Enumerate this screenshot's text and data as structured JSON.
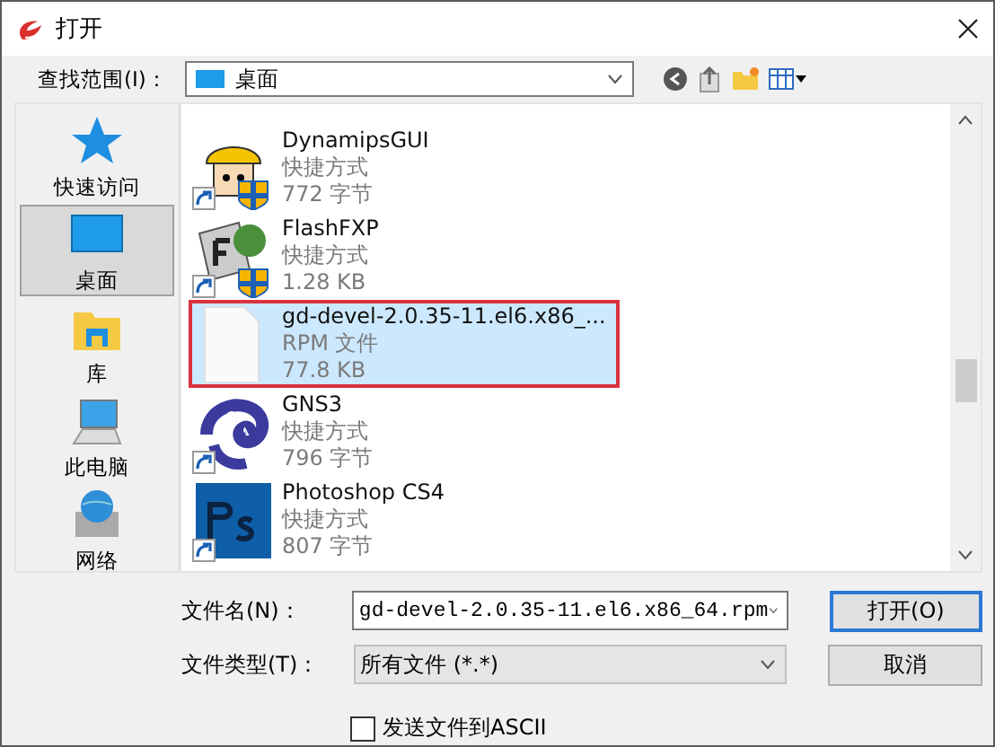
{
  "window": {
    "title": "打开"
  },
  "look_in": {
    "label": "查找范围(I)：",
    "value": "桌面"
  },
  "places": [
    {
      "label": "快速访问",
      "kind": "star",
      "selected": false
    },
    {
      "label": "桌面",
      "kind": "desktop",
      "selected": true
    },
    {
      "label": "库",
      "kind": "library",
      "selected": false
    },
    {
      "label": "此电脑",
      "kind": "computer",
      "selected": false
    },
    {
      "label": "网络",
      "kind": "network",
      "selected": false
    }
  ],
  "files": [
    {
      "name": "DynamipsGUI",
      "type": "快捷方式",
      "size": "772 字节",
      "kind": "hardhat",
      "shortcut": true,
      "selected": false,
      "highlighted": false
    },
    {
      "name": "FlashFXP",
      "type": "快捷方式",
      "size": "1.28 KB",
      "kind": "ftp",
      "shortcut": true,
      "selected": false,
      "highlighted": false
    },
    {
      "name": "gd-devel-2.0.35-11.el6.x86_...",
      "type": "RPM 文件",
      "size": "77.8 KB",
      "kind": "document",
      "shortcut": false,
      "selected": true,
      "highlighted": true
    },
    {
      "name": "GNS3",
      "type": "快捷方式",
      "size": "796 字节",
      "kind": "chameleon",
      "shortcut": true,
      "selected": false,
      "highlighted": false
    },
    {
      "name": "Photoshop CS4",
      "type": "快捷方式",
      "size": "807 字节",
      "kind": "ps",
      "shortcut": true,
      "selected": false,
      "highlighted": false
    }
  ],
  "file_name": {
    "label": "文件名(N)：",
    "value": "gd-devel-2.0.35-11.el6.x86_64.rpm"
  },
  "file_type": {
    "label": "文件类型(T)：",
    "value": "所有文件 (*.*)"
  },
  "buttons": [
    {
      "label": "打开(O)",
      "default": true
    },
    {
      "label": "取消",
      "default": false
    }
  ],
  "send_ascii": {
    "label": "发送文件到ASCII",
    "checked": false
  }
}
